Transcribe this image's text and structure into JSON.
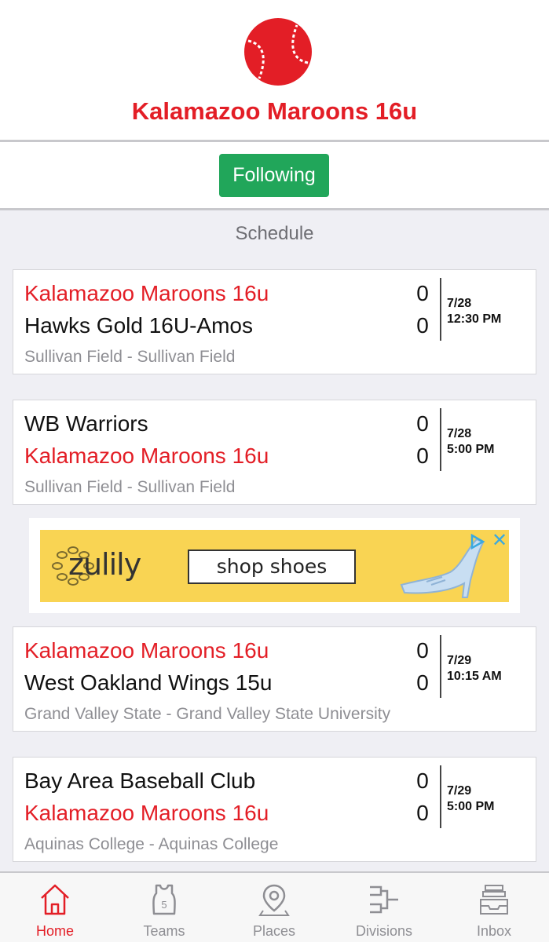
{
  "header": {
    "title": "Kalamazoo Maroons 16u",
    "logo_icon": "baseball-icon"
  },
  "follow": {
    "label": "Following"
  },
  "schedule": {
    "title": "Schedule",
    "games": [
      {
        "team1": {
          "name": "Kalamazoo Maroons 16u",
          "highlight": true,
          "score": "0"
        },
        "team2": {
          "name": "Hawks Gold 16U-Amos",
          "highlight": false,
          "score": "0"
        },
        "date": "7/28",
        "time": "12:30 PM",
        "location": "Sullivan Field - Sullivan Field"
      },
      {
        "team1": {
          "name": "WB Warriors",
          "highlight": false,
          "score": "0"
        },
        "team2": {
          "name": "Kalamazoo Maroons 16u",
          "highlight": true,
          "score": "0"
        },
        "date": "7/28",
        "time": "5:00 PM",
        "location": "Sullivan Field - Sullivan Field"
      },
      {
        "team1": {
          "name": "Kalamazoo Maroons 16u",
          "highlight": true,
          "score": "0"
        },
        "team2": {
          "name": "West Oakland Wings 15u",
          "highlight": false,
          "score": "0"
        },
        "date": "7/29",
        "time": "10:15 AM",
        "location": "Grand Valley State - Grand Valley State University"
      },
      {
        "team1": {
          "name": "Bay Area Baseball Club",
          "highlight": false,
          "score": "0"
        },
        "team2": {
          "name": "Kalamazoo Maroons 16u",
          "highlight": true,
          "score": "0"
        },
        "date": "7/29",
        "time": "5:00 PM",
        "location": "Aquinas College - Aquinas College"
      }
    ]
  },
  "ad": {
    "brand": "zulily",
    "cta": "shop shoes",
    "close": "✕"
  },
  "tabbar": {
    "tabs": [
      {
        "label": "Home",
        "icon": "home-icon",
        "active": true
      },
      {
        "label": "Teams",
        "icon": "jersey-icon",
        "active": false
      },
      {
        "label": "Places",
        "icon": "map-pin-icon",
        "active": false
      },
      {
        "label": "Divisions",
        "icon": "bracket-icon",
        "active": false
      },
      {
        "label": "Inbox",
        "icon": "inbox-tray-icon",
        "active": false
      }
    ]
  },
  "colors": {
    "brand_red": "#e31e26",
    "follow_green": "#21a65a",
    "ad_yellow": "#f9d453"
  }
}
